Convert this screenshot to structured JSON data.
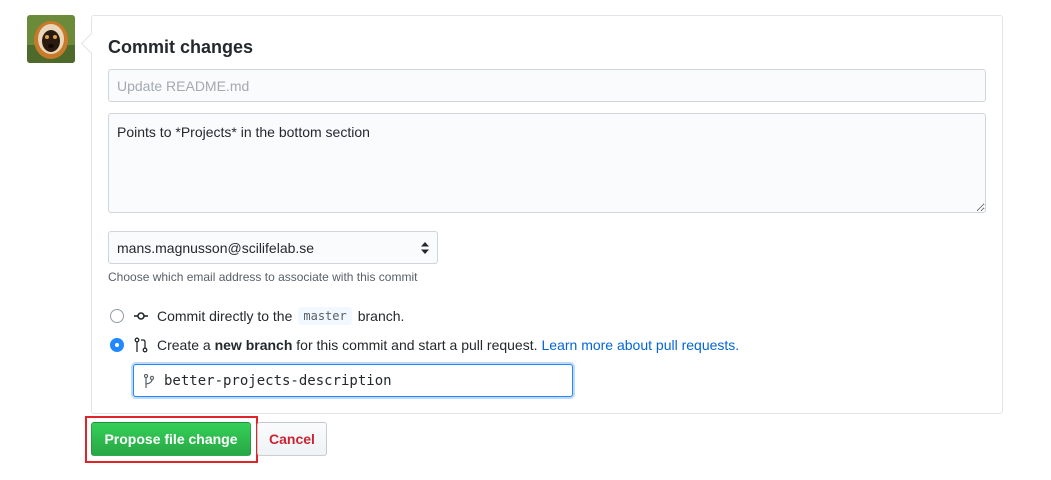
{
  "commit_form": {
    "title": "Commit changes",
    "summary_placeholder": "Update README.md",
    "summary_value": "",
    "description_value": "Points to *Projects* in the bottom section",
    "email_selected": "mans.magnusson@scilifelab.se",
    "email_note": "Choose which email address to associate with this commit",
    "option_direct": {
      "prefix": "Commit directly to the",
      "branch": "master",
      "suffix": "branch."
    },
    "option_new_branch": {
      "prefix": "Create a",
      "bold": "new branch",
      "suffix": "for this commit and start a pull request.",
      "link": "Learn more about pull requests."
    },
    "new_branch_name": "better-projects-description"
  },
  "actions": {
    "propose_label": "Propose file change",
    "cancel_label": "Cancel"
  },
  "colors": {
    "primary_green": "#28a745",
    "cancel_red": "#cb2431",
    "link_blue": "#0366d6",
    "highlight_red": "#e0252a"
  },
  "icons": {
    "commit_icon": "git-commit-icon",
    "pull_request_icon": "git-pull-request-icon",
    "branch_icon": "git-branch-icon",
    "select_arrows": "unfold-icon"
  }
}
